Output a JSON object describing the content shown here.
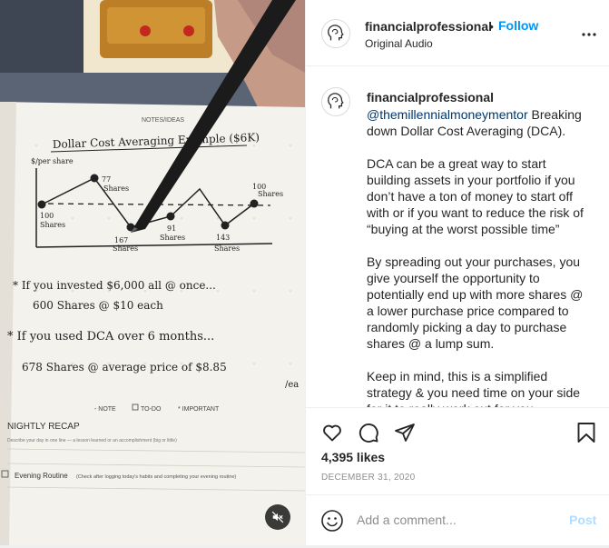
{
  "header": {
    "username": "financialprofessional",
    "dot": "•",
    "follow_label": "Follow",
    "audio": "Original Audio"
  },
  "caption": {
    "username": "financialprofessional",
    "mention": "@themillennialmoneymentor",
    "intro": " Breaking down Dollar Cost Averaging (DCA).",
    "paragraphs": [
      "DCA can be a great way to start building assets in your portfolio if you don’t have a ton of money to start off with or if you want to reduce the risk of “buying at the worst possible time”",
      "By spreading out your purchases, you give yourself the opportunity to potentially end up with more shares @ a lower purchase price compared to randomly picking a day to purchase shares @ a lump sum.",
      "Keep in mind, this is a simplified strategy & you need time on your side for it to really work out for you."
    ]
  },
  "stats": {
    "likes": "4,395 likes",
    "date": "December 31, 2020"
  },
  "comment": {
    "placeholder": "Add a comment...",
    "post_label": "Post"
  },
  "notebook": {
    "header": "NOTES/IDEAS",
    "title": "Dollar Cost Averaging Example ($6K)",
    "y_label": "$/per share",
    "points": [
      {
        "label": "100",
        "sub": "Shares"
      },
      {
        "label": "77",
        "sub": "Shares"
      },
      {
        "label": "167",
        "sub": "Shares"
      },
      {
        "label": "91",
        "sub": "Shares"
      },
      {
        "label": "143",
        "sub": "Shares"
      },
      {
        "label": "100",
        "sub": "Shares"
      }
    ],
    "line1": "* If you invested $6,000 all @ once...",
    "line2": "600 Shares @ $10 each",
    "line3": "* If you used DCA over 6 months...",
    "line4": "678 Shares @ average price of $8.85",
    "line4_tail": "/ea",
    "legend_note": "- NOTE",
    "legend_todo": "TO-DO",
    "legend_important": "* IMPORTANT",
    "recap_title": "NIGHTLY RECAP",
    "recap_sub": "Describe your day in one line — a lesson learned or an accomplishment (big or little)",
    "routine_title": "Evening Routine",
    "routine_sub": "(Check after logging today's habits and completing your evening routine)"
  },
  "colors": {
    "accent": "#0095f6",
    "mention": "#00376b",
    "muted": "#8e8e8e",
    "post_disabled": "#b3dbff"
  }
}
